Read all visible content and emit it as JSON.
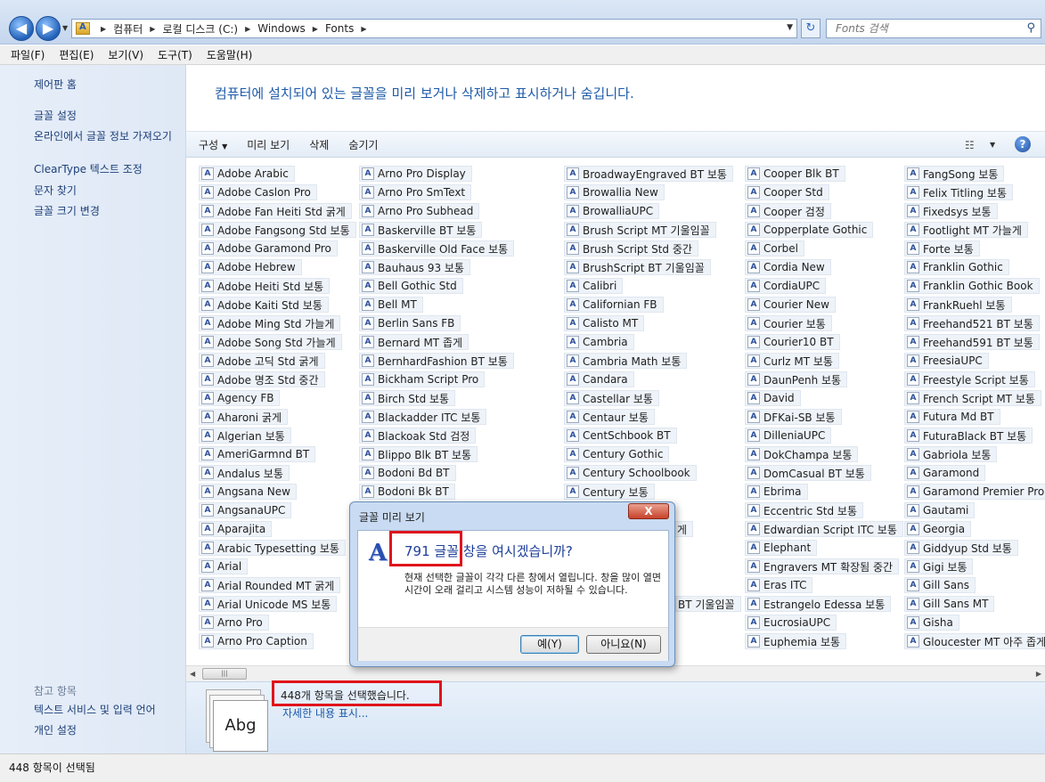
{
  "addressbar": {
    "crumbs": [
      "컴퓨터",
      "로컬 디스크 (C:)",
      "Windows",
      "Fonts"
    ],
    "search_placeholder": "Fonts 검색"
  },
  "menubar": [
    "파일(F)",
    "편집(E)",
    "보기(V)",
    "도구(T)",
    "도움말(H)"
  ],
  "leftpane": {
    "links": [
      "제어판 홈",
      "글꼴 설정",
      "온라인에서 글꼴 정보 가져오기",
      "ClearType 텍스트 조정",
      "문자 찾기",
      "글꼴 크기 변경"
    ],
    "see_also_heading": "참고 항목",
    "see_also_links": [
      "텍스트 서비스 및 입력 언어",
      "개인 설정"
    ]
  },
  "main": {
    "headline": "컴퓨터에 설치되어 있는 글꼴을 미리 보거나 삭제하고 표시하거나 숨깁니다.",
    "commands": [
      "구성",
      "미리 보기",
      "삭제",
      "숨기기"
    ]
  },
  "columns": [
    [
      "Adobe Arabic",
      "Adobe Caslon Pro",
      "Adobe Fan Heiti Std 굵게",
      "Adobe Fangsong Std 보통",
      "Adobe Garamond Pro",
      "Adobe Hebrew",
      "Adobe Heiti Std 보통",
      "Adobe Kaiti Std 보통",
      "Adobe Ming Std 가늘게",
      "Adobe Song Std 가늘게",
      "Adobe 고딕 Std 굵게",
      "Adobe 명조 Std 중간",
      "Agency FB",
      "Aharoni 굵게",
      "Algerian 보통",
      "AmeriGarmnd BT",
      "Andalus 보통",
      "Angsana New",
      "AngsanaUPC",
      "Aparajita",
      "Arabic Typesetting 보통",
      "Arial",
      "Arial Rounded MT 굵게",
      "Arial Unicode MS 보통",
      "Arno Pro",
      "Arno Pro Caption"
    ],
    [
      "Arno Pro Display",
      "Arno Pro SmText",
      "Arno Pro Subhead",
      "Baskerville BT 보통",
      "Baskerville Old Face 보통",
      "Bauhaus 93 보통",
      "Bell Gothic Std",
      "Bell MT",
      "Berlin Sans FB",
      "Bernard MT 좁게",
      "BernhardFashion BT 보통",
      "Bickham Script Pro",
      "Birch Std 보통",
      "Blackadder ITC 보통",
      "Blackoak Std 검정",
      "Blippo Blk BT 보통",
      "Bodoni Bd BT",
      "Bodoni Bk BT"
    ],
    [
      "BroadwayEngraved BT 보통",
      "Browallia New",
      "BrowalliaUPC",
      "Brush Script MT 기울임꼴",
      "Brush Script Std 중간",
      "BrushScript BT 기울임꼴",
      "Calibri",
      "Californian FB",
      "Calisto MT",
      "Cambria",
      "Cambria Math 보통",
      "Candara",
      "Castellar 보통",
      "Centaur 보통",
      "CentSchbook BT",
      "Century Gothic",
      "Century Schoolbook",
      "Century 보통"
    ],
    [
      "Cooper Blk BT",
      "Cooper Std",
      "Cooper 검정",
      "Copperplate Gothic",
      "Corbel",
      "Cordia New",
      "CordiaUPC",
      "Courier New",
      "Courier 보통",
      "Courier10 BT",
      "Curlz MT 보통",
      "DaunPenh 보통",
      "David",
      "DFKai-SB 보통",
      "DilleniaUPC",
      "DokChampa 보통",
      "DomCasual BT 보통",
      "Ebrima",
      "Eccentric Std 보통",
      "Edwardian Script ITC 보통",
      "Elephant",
      "Engravers MT 확장됨 중간",
      "Eras ITC",
      "Estrangelo Edessa 보통",
      "EucrosiaUPC",
      "Euphemia 보통"
    ],
    [
      "FangSong 보통",
      "Felix Titling 보통",
      "Fixedsys 보통",
      "Footlight MT 가늘게",
      "Forte 보통",
      "Franklin Gothic",
      "Franklin Gothic Book",
      "FrankRuehl 보통",
      "Freehand521 BT 보통",
      "Freehand591 BT 보통",
      "FreesiaUPC",
      "Freestyle Script 보통",
      "French Script MT 보통",
      "Futura Md BT",
      "FuturaBlack BT 보통",
      "Gabriola 보통",
      "Garamond",
      "Garamond Premier Pro",
      "Gautami",
      "Georgia",
      "Giddyup Std 보통",
      "Gigi 보통",
      "Gill Sans",
      "Gill Sans MT",
      "Gisha",
      "Gloucester MT 아주 좁게"
    ]
  ],
  "partially_visible": {
    "col2_behind_dialog_suffix": "게",
    "col3_behind_dialog_suffix": "BT 기울임꼴"
  },
  "details": {
    "tile_text": "Abg",
    "selection": "448개 항목을 선택했습니다.",
    "more_link": "자세한 내용 표시..."
  },
  "statusbar": "448 항목이 선택됨",
  "dialog": {
    "title": "글꼴 미리 보기",
    "close": "X",
    "question": "791 글꼴 창을 여시겠습니까?",
    "description": "현재 선택한 글꼴이 각각 다른 창에서 열립니다. 창을 많이 열면 시간이 오래 걸리고 시스템 성능이 저하될 수 있습니다.",
    "yes": "예(Y)",
    "no": "아니요(N)"
  },
  "colors": {
    "highlight": "#e0141c",
    "link": "#1e5aa8"
  }
}
